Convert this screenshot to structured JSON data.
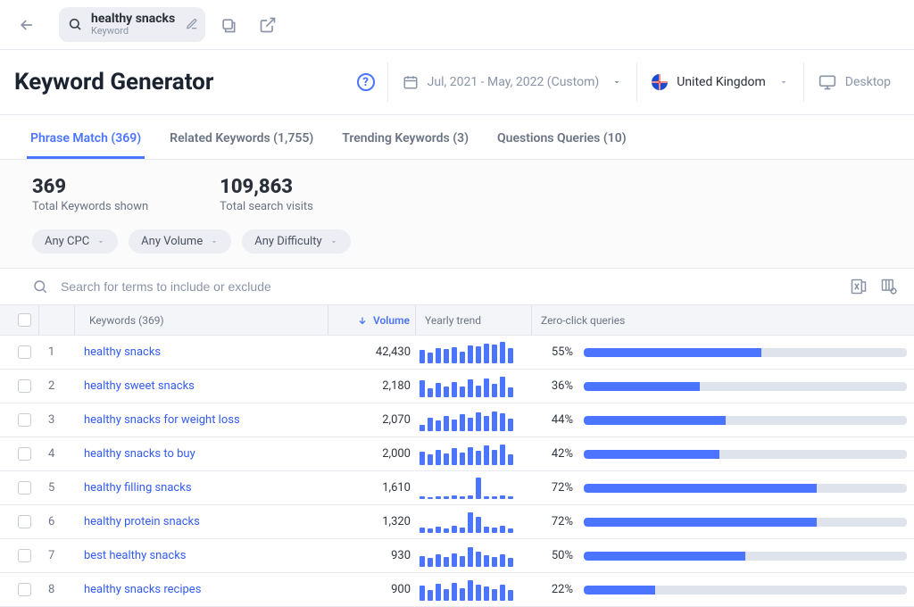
{
  "topbar": {
    "term": "healthy snacks",
    "term_type": "Keyword"
  },
  "header": {
    "title": "Keyword Generator",
    "date_range": "Jul, 2021 - May, 2022 (Custom)",
    "country": "United Kingdom",
    "device": "Desktop"
  },
  "tabs": [
    {
      "label": "Phrase Match (369)",
      "active": true
    },
    {
      "label": "Related Keywords (1,755)"
    },
    {
      "label": "Trending Keywords (3)"
    },
    {
      "label": "Questions Queries (10)"
    }
  ],
  "summary": {
    "kw_count": "369",
    "kw_label": "Total Keywords shown",
    "visits": "109,863",
    "visits_label": "Total search visits"
  },
  "filters": {
    "cpc": "Any CPC",
    "volume": "Any Volume",
    "difficulty": "Any Difficulty"
  },
  "search": {
    "placeholder": "Search for terms to include or exclude"
  },
  "columns": {
    "keywords": "Keywords (369)",
    "volume": "Volume",
    "trend": "Yearly trend",
    "zcq": "Zero-click queries"
  },
  "rows": [
    {
      "idx": "1",
      "keyword": "healthy snacks",
      "volume": "42,430",
      "zcq": 55,
      "trend": [
        62,
        48,
        70,
        65,
        72,
        54,
        82,
        76,
        90,
        84,
        96,
        70
      ]
    },
    {
      "idx": "2",
      "keyword": "healthy sweet snacks",
      "volume": "2,180",
      "zcq": 36,
      "trend": [
        78,
        38,
        66,
        50,
        70,
        46,
        80,
        54,
        86,
        60,
        92,
        44
      ]
    },
    {
      "idx": "3",
      "keyword": "healthy snacks for weight loss",
      "volume": "2,070",
      "zcq": 44,
      "trend": [
        28,
        60,
        46,
        70,
        54,
        78,
        62,
        84,
        70,
        90,
        80,
        58
      ]
    },
    {
      "idx": "4",
      "keyword": "healthy snacks to buy",
      "volume": "2,000",
      "zcq": 42,
      "trend": [
        60,
        46,
        70,
        52,
        76,
        58,
        82,
        64,
        88,
        70,
        94,
        50
      ]
    },
    {
      "idx": "5",
      "keyword": "healthy filling snacks",
      "volume": "1,610",
      "zcq": 72,
      "trend": [
        10,
        8,
        12,
        9,
        14,
        10,
        16,
        96,
        12,
        10,
        14,
        9
      ]
    },
    {
      "idx": "6",
      "keyword": "healthy protein snacks",
      "volume": "1,320",
      "zcq": 72,
      "trend": [
        22,
        18,
        26,
        20,
        30,
        24,
        94,
        74,
        28,
        22,
        30,
        20
      ]
    },
    {
      "idx": "7",
      "keyword": "best healthy snacks",
      "volume": "930",
      "zcq": 50,
      "trend": [
        50,
        38,
        56,
        42,
        62,
        46,
        90,
        70,
        52,
        44,
        58,
        40
      ]
    },
    {
      "idx": "8",
      "keyword": "healthy snacks recipes",
      "volume": "900",
      "zcq": 22,
      "trend": [
        70,
        50,
        76,
        54,
        80,
        58,
        92,
        74,
        66,
        52,
        72,
        48
      ]
    }
  ]
}
